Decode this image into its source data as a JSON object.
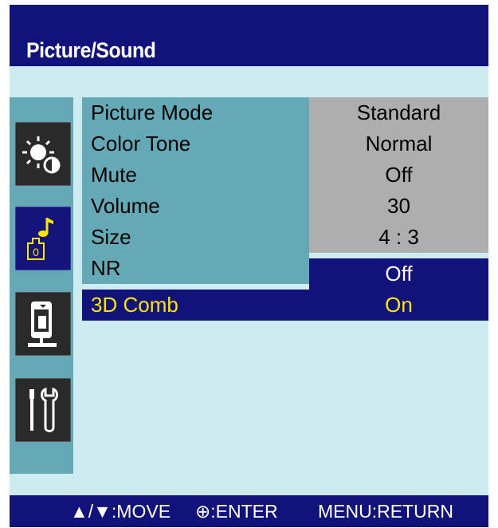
{
  "title": "Picture/Sound",
  "icons": [
    "brightness-contrast-icon",
    "music-note-icon",
    "display-setup-icon",
    "tools-icon"
  ],
  "menu": [
    {
      "label": "Picture Mode",
      "value": "Standard"
    },
    {
      "label": "Color Tone",
      "value": "Normal"
    },
    {
      "label": "Mute",
      "value": "Off"
    },
    {
      "label": "Volume",
      "value": "30"
    },
    {
      "label": "Size",
      "value": "4 : 3"
    },
    {
      "label": "NR",
      "value": "Off"
    },
    {
      "label": "3D Comb",
      "value": "On"
    }
  ],
  "footer": {
    "move": "▲/▼:MOVE",
    "enter": "⊕:ENTER",
    "return": "MENU:RETURN"
  },
  "colors": {
    "navy": "#12137a",
    "background": "#cdebf1",
    "label_bg": "#66a9b6",
    "value_bg": "#aeaeae",
    "selected_text": "#ffe600"
  }
}
